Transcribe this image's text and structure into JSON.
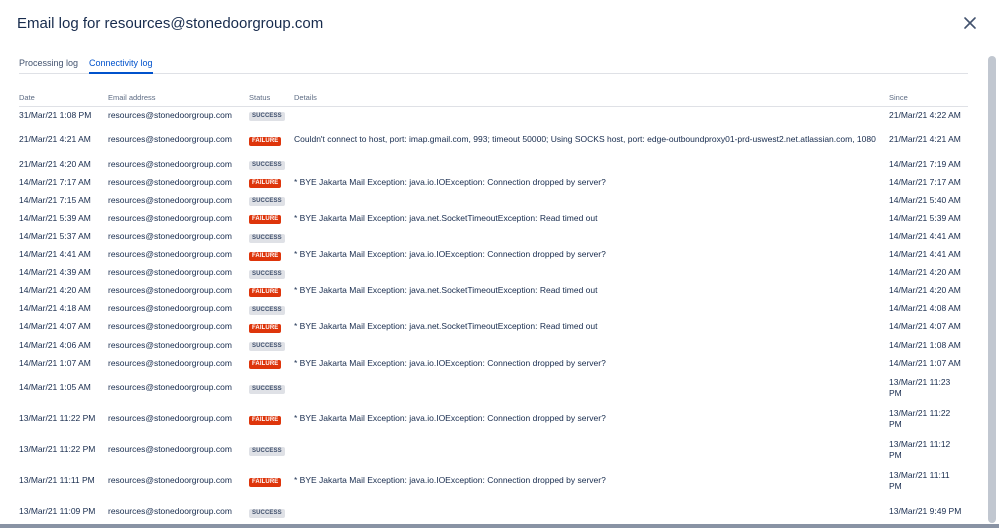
{
  "dialog": {
    "title": "Email log for resources@stonedoorgroup.com"
  },
  "tabs": [
    "Processing log",
    "Connectivity log"
  ],
  "active_tab": "Connectivity log",
  "table": {
    "headers": {
      "date": "Date",
      "email": "Email address",
      "status": "Status",
      "details": "Details",
      "since": "Since"
    },
    "rows": [
      {
        "date": "31/Mar/21 1:08 PM",
        "email": "resources@stonedoorgroup.com",
        "status": "SUCCESS",
        "details": "",
        "since": "21/Mar/21 4:22 AM"
      },
      {
        "date": "21/Mar/21 4:21 AM",
        "email": "resources@stonedoorgroup.com",
        "status": "FAILURE",
        "details": "Couldn't connect to host, port: imap.gmail.com, 993; timeout 50000; Using SOCKS host, port: edge-outboundproxy01-prd-uswest2.net.atlassian.com, 1080",
        "since": "21/Mar/21 4:21 AM"
      },
      {
        "date": "21/Mar/21 4:20 AM",
        "email": "resources@stonedoorgroup.com",
        "status": "SUCCESS",
        "details": "",
        "since": "14/Mar/21 7:19 AM"
      },
      {
        "date": "14/Mar/21 7:17 AM",
        "email": "resources@stonedoorgroup.com",
        "status": "FAILURE",
        "details": "* BYE Jakarta Mail Exception: java.io.IOException: Connection dropped by server?",
        "since": "14/Mar/21 7:17 AM"
      },
      {
        "date": "14/Mar/21 7:15 AM",
        "email": "resources@stonedoorgroup.com",
        "status": "SUCCESS",
        "details": "",
        "since": "14/Mar/21 5:40 AM"
      },
      {
        "date": "14/Mar/21 5:39 AM",
        "email": "resources@stonedoorgroup.com",
        "status": "FAILURE",
        "details": "* BYE Jakarta Mail Exception: java.net.SocketTimeoutException: Read timed out",
        "since": "14/Mar/21 5:39 AM"
      },
      {
        "date": "14/Mar/21 5:37 AM",
        "email": "resources@stonedoorgroup.com",
        "status": "SUCCESS",
        "details": "",
        "since": "14/Mar/21 4:41 AM"
      },
      {
        "date": "14/Mar/21 4:41 AM",
        "email": "resources@stonedoorgroup.com",
        "status": "FAILURE",
        "details": "* BYE Jakarta Mail Exception: java.io.IOException: Connection dropped by server?",
        "since": "14/Mar/21 4:41 AM"
      },
      {
        "date": "14/Mar/21 4:39 AM",
        "email": "resources@stonedoorgroup.com",
        "status": "SUCCESS",
        "details": "",
        "since": "14/Mar/21 4:20 AM"
      },
      {
        "date": "14/Mar/21 4:20 AM",
        "email": "resources@stonedoorgroup.com",
        "status": "FAILURE",
        "details": "* BYE Jakarta Mail Exception: java.net.SocketTimeoutException: Read timed out",
        "since": "14/Mar/21 4:20 AM"
      },
      {
        "date": "14/Mar/21 4:18 AM",
        "email": "resources@stonedoorgroup.com",
        "status": "SUCCESS",
        "details": "",
        "since": "14/Mar/21 4:08 AM"
      },
      {
        "date": "14/Mar/21 4:07 AM",
        "email": "resources@stonedoorgroup.com",
        "status": "FAILURE",
        "details": "* BYE Jakarta Mail Exception: java.net.SocketTimeoutException: Read timed out",
        "since": "14/Mar/21 4:07 AM"
      },
      {
        "date": "14/Mar/21 4:06 AM",
        "email": "resources@stonedoorgroup.com",
        "status": "SUCCESS",
        "details": "",
        "since": "14/Mar/21 1:08 AM"
      },
      {
        "date": "14/Mar/21 1:07 AM",
        "email": "resources@stonedoorgroup.com",
        "status": "FAILURE",
        "details": "* BYE Jakarta Mail Exception: java.io.IOException: Connection dropped by server?",
        "since": "14/Mar/21 1:07 AM"
      },
      {
        "date": "14/Mar/21 1:05 AM",
        "email": "resources@stonedoorgroup.com",
        "status": "SUCCESS",
        "details": "",
        "since": "13/Mar/21 11:23 PM"
      },
      {
        "date": "13/Mar/21 11:22 PM",
        "email": "resources@stonedoorgroup.com",
        "status": "FAILURE",
        "details": "* BYE Jakarta Mail Exception: java.io.IOException: Connection dropped by server?",
        "since": "13/Mar/21 11:22 PM"
      },
      {
        "date": "13/Mar/21 11:22 PM",
        "email": "resources@stonedoorgroup.com",
        "status": "SUCCESS",
        "details": "",
        "since": "13/Mar/21 11:12 PM"
      },
      {
        "date": "13/Mar/21 11:11 PM",
        "email": "resources@stonedoorgroup.com",
        "status": "FAILURE",
        "details": "* BYE Jakarta Mail Exception: java.io.IOException: Connection dropped by server?",
        "since": "13/Mar/21 11:11 PM"
      },
      {
        "date": "13/Mar/21 11:09 PM",
        "email": "resources@stonedoorgroup.com",
        "status": "SUCCESS",
        "details": "",
        "since": "13/Mar/21 9:49 PM"
      }
    ]
  },
  "icons": {
    "close": "close-icon"
  },
  "colors": {
    "accent": "#0052cc",
    "failure": "#de350b",
    "success_bg": "#dfe1e6",
    "text": "#172b4d",
    "muted": "#5e6c84"
  }
}
